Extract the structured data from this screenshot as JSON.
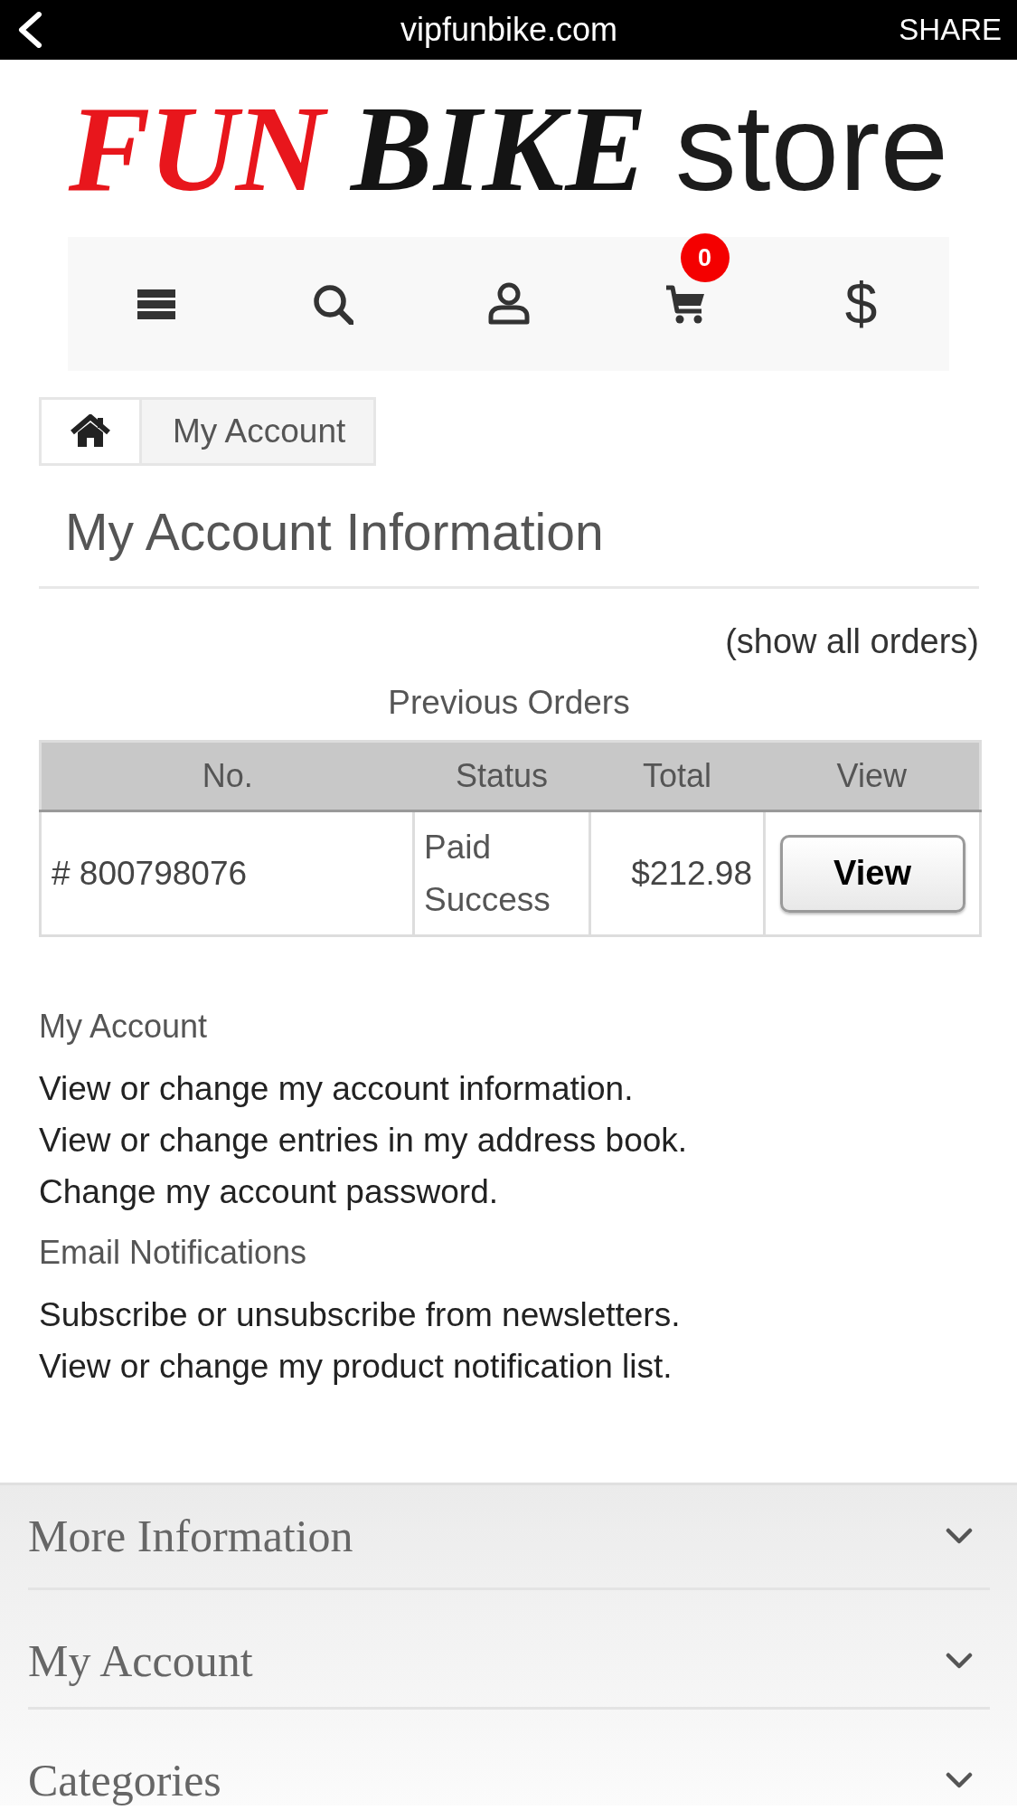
{
  "browser_bar": {
    "title": "vipfunbike.com",
    "action": "SHARE"
  },
  "logo": {
    "words": [
      {
        "text": "FUN",
        "kind": "accent"
      },
      {
        "text": "BIKE",
        "kind": "strong"
      },
      {
        "text": "store",
        "kind": "plain"
      }
    ]
  },
  "toolbar": {
    "items": [
      {
        "kind": "menu"
      },
      {
        "kind": "search"
      },
      {
        "kind": "account"
      },
      {
        "kind": "cart",
        "badge": "0"
      },
      {
        "kind": "currency",
        "label": "$"
      }
    ]
  },
  "breadcrumb": [
    {
      "kind": "home"
    },
    {
      "kind": "page",
      "label": "My Account"
    }
  ],
  "page_title": "My Account Information",
  "show_all_orders": "(show all orders)",
  "orders": {
    "caption": "Previous Orders",
    "columns": [
      "No.",
      "Status",
      "Total",
      "View"
    ],
    "rows": [
      {
        "number": "# 800798076",
        "status": "Paid Success",
        "total": "$212.98",
        "action": "View"
      }
    ]
  },
  "sections": [
    {
      "heading": "My Account",
      "links": [
        "View or change my account information.",
        "View or change entries in my address book.",
        "Change my account password."
      ]
    },
    {
      "heading": "Email Notifications",
      "links": [
        "Subscribe or unsubscribe from newsletters.",
        "View or change my product notification list."
      ]
    }
  ],
  "footer": {
    "items": [
      {
        "label": "More Information",
        "expanded": false
      },
      {
        "label": "My Account",
        "expanded": false
      },
      {
        "label": "Categories",
        "expanded": false
      }
    ]
  }
}
